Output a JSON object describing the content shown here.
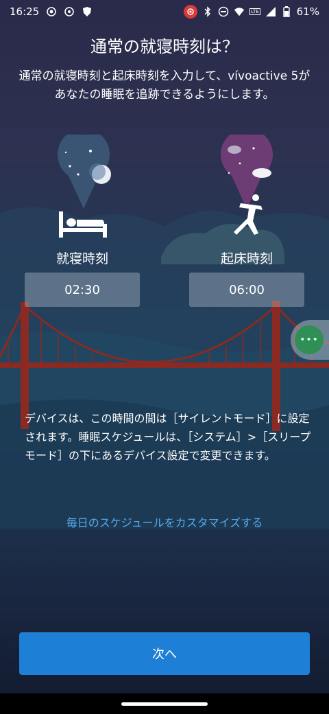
{
  "status_bar": {
    "time": "16:25",
    "battery_percent": "61%",
    "lte_badge": "LTE",
    "icons": [
      "nfc-icon",
      "target-icon",
      "shield-icon",
      "record-icon",
      "bluetooth-icon",
      "dnd-icon",
      "wifi-icon",
      "signal-icon",
      "battery-icon"
    ]
  },
  "header": {
    "title": "通常の就寝時刻は？",
    "subtitle": "通常の就寝時刻と起床時刻を入力して、vívoactive 5があなたの睡眠を追跡できるようにします。"
  },
  "bedtime": {
    "label": "就寝時刻",
    "value": "02:30",
    "icon": "bed-icon",
    "pin_icon": "moon-icon"
  },
  "wake": {
    "label": "起床時刻",
    "value": "06:00",
    "icon": "stretch-icon",
    "pin_icon": "cloud-icon"
  },
  "info_text": "デバイスは、この時間の間は［サイレントモード］に設定されます。睡眠スケジュールは、［システム］>［スリープモード］の下にあるデバイス設定で変更できます。",
  "customize_link": "毎日のスケジュールをカスタマイズする",
  "next_button": "次へ",
  "fab_icon": "chat-bubble-icon",
  "colors": {
    "accent": "#1e7fd6",
    "link": "#58a9ef",
    "bridge": "#8a2a22",
    "moon_pin": "#3d5a7a",
    "sun_pin": "#7a3e7a"
  }
}
